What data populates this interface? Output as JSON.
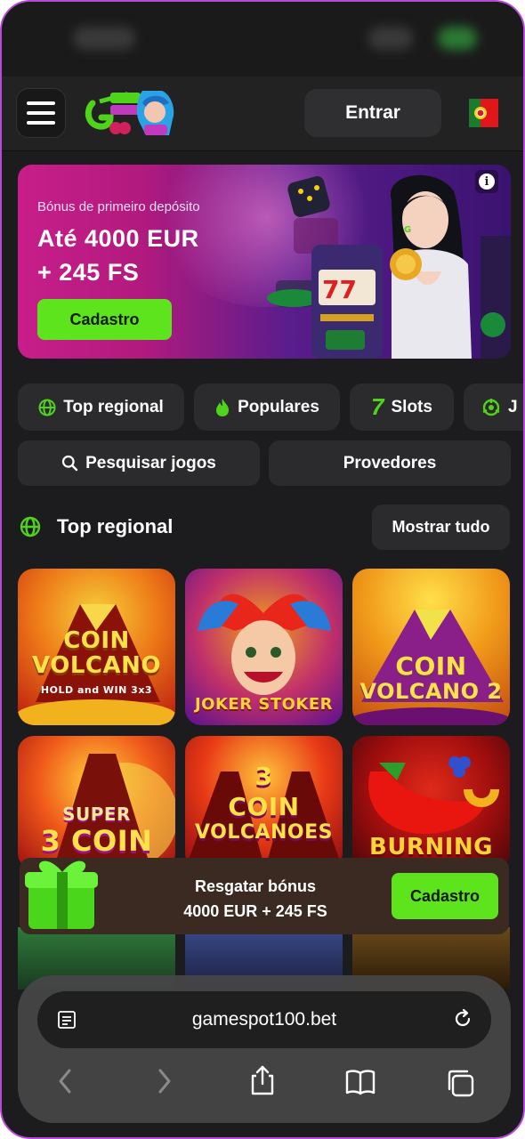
{
  "header": {
    "login_label": "Entrar",
    "logo_name": "GameSpot"
  },
  "hero": {
    "subtitle": "Bónus de primeiro depósito",
    "title_line1": "Até 4000 EUR",
    "title_line2": "+ 245 FS",
    "cta_label": "Cadastro",
    "info_glyph": "i"
  },
  "categories": [
    {
      "label": "Top regional",
      "icon": "globe-icon"
    },
    {
      "label": "Populares",
      "icon": "flame-icon"
    },
    {
      "label": "Slots",
      "icon": "seven-icon",
      "glyph": "7"
    },
    {
      "label": "J",
      "icon": "joystick-icon"
    }
  ],
  "search": {
    "label": "Pesquisar jogos"
  },
  "providers": {
    "label": "Provedores"
  },
  "section": {
    "title": "Top regional",
    "show_all_label": "Mostrar tudo"
  },
  "games": [
    {
      "line1": "COIN",
      "line2": "VOLCANO",
      "line3": "HOLD and WIN 3x3"
    },
    {
      "line1": "JOKER STOKER"
    },
    {
      "line1": "COIN",
      "line2": "VOLCANO 2"
    },
    {
      "line1": "SUPER",
      "line2": "3 COIN"
    },
    {
      "line1": "3",
      "line2": "COIN",
      "line3": "VOLCANOES"
    },
    {
      "line1": "BURNING"
    }
  ],
  "bonus_bar": {
    "line1": "Resgatar bónus",
    "line2": "4000 EUR + 245 FS",
    "cta_label": "Cadastro"
  },
  "browser": {
    "url": "gamespot100.bet"
  },
  "colors": {
    "accent_green": "#5ee41c",
    "background": "#1c1c1e",
    "chip": "#2b2b2d",
    "frame_border": "#b54ad6"
  }
}
